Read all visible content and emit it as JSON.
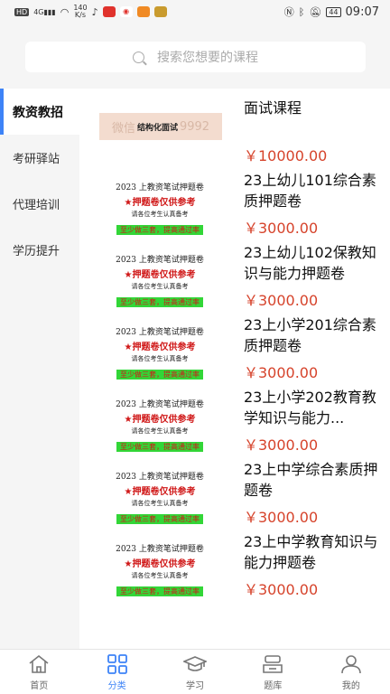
{
  "status_bar": {
    "left_chip": "HD",
    "signal": "4G",
    "net_speed_value": "140",
    "net_speed_unit": "K/s",
    "battery": "44",
    "time": "09:07"
  },
  "search": {
    "placeholder": "搜索您想要的课程"
  },
  "sidebar": {
    "items": [
      {
        "label": "教资教招",
        "active": true
      },
      {
        "label": "考研驿站"
      },
      {
        "label": "代理培训"
      },
      {
        "label": "学历提升"
      }
    ]
  },
  "courses": [
    {
      "name": "面试课程",
      "price": "￥10000.00",
      "thumb": {
        "watermark_left": "微信",
        "tag": "结构化面试",
        "watermark_right": "9992"
      }
    },
    {
      "name": "23上幼儿101综合素质押题卷",
      "price": "￥3000.00",
      "thumb": {
        "title": "2023 上教资笔试押题卷",
        "red": "★押题卷仅供参考",
        "small": "请各位考生认真备考",
        "green": "至少做三套，提高通过率"
      }
    },
    {
      "name": "23上幼儿102保教知识与能力押题卷",
      "price": "￥3000.00",
      "thumb": {
        "title": "2023 上教资笔试押题卷",
        "red": "★押题卷仅供参考",
        "small": "请各位考生认真备考",
        "green": "至少做三套，提高通过率"
      }
    },
    {
      "name": "23上小学201综合素质押题卷",
      "price": "￥3000.00",
      "thumb": {
        "title": "2023 上教资笔试押题卷",
        "red": "★押题卷仅供参考",
        "small": "请各位考生认真备考",
        "green": "至少做三套，提高通过率"
      }
    },
    {
      "name": "23上小学202教育教学知识与能力...",
      "price": "￥3000.00",
      "thumb": {
        "title": "2023 上教资笔试押题卷",
        "red": "★押题卷仅供参考",
        "small": "请各位考生认真备考",
        "green": "至少做三套，提高通过率"
      }
    },
    {
      "name": "23上中学综合素质押题卷",
      "price": "￥3000.00",
      "thumb": {
        "title": "2023 上教资笔试押题卷",
        "red": "★押题卷仅供参考",
        "small": "请各位考生认真备考",
        "green": "至少做三套，提高通过率"
      }
    },
    {
      "name": "23上中学教育知识与能力押题卷",
      "price": "￥3000.00",
      "thumb": {
        "title": "2023 上教资笔试押题卷",
        "red": "★押题卷仅供参考",
        "small": "请各位考生认真备考",
        "green": "至少做三套，提高通过率"
      }
    }
  ],
  "tabbar": {
    "items": [
      {
        "label": "首页",
        "icon": "home-icon"
      },
      {
        "label": "分类",
        "icon": "category-icon",
        "active": true
      },
      {
        "label": "学习",
        "icon": "graduation-cap-icon"
      },
      {
        "label": "题库",
        "icon": "question-bank-icon"
      },
      {
        "label": "我的",
        "icon": "user-icon"
      }
    ]
  },
  "colors": {
    "accent": "#3d83f7",
    "price": "#d6432b",
    "background": "#f5f5f5"
  }
}
